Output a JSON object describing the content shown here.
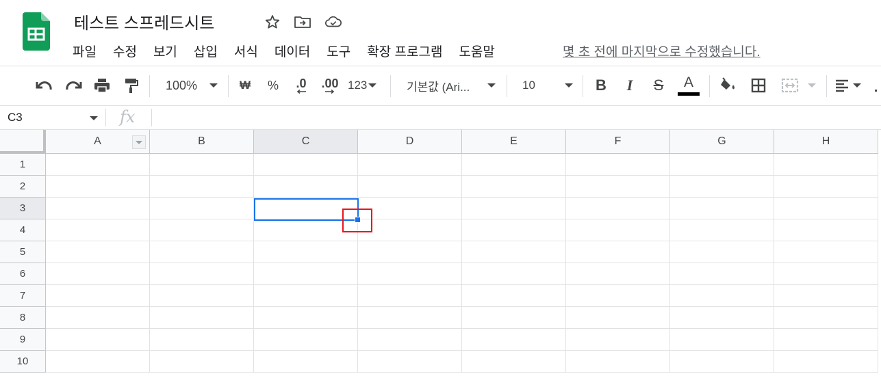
{
  "app": {
    "title": "테스트 스프레드시트",
    "accent": "#1a73e8",
    "brand": "#0f9d58",
    "header_icons": [
      "star-icon",
      "move-to-folder-icon",
      "cloud-saved-icon"
    ]
  },
  "menu": {
    "items": [
      "파일",
      "수정",
      "보기",
      "삽입",
      "서식",
      "데이터",
      "도구",
      "확장 프로그램",
      "도움말"
    ],
    "last_edit": "몇 초 전에 마지막으로 수정했습니다."
  },
  "toolbar": {
    "undo_icon": "undo-icon",
    "redo_icon": "redo-icon",
    "print_icon": "print-icon",
    "paint_format_icon": "paint-format-icon",
    "zoom": "100%",
    "currency": "₩",
    "percent": "%",
    "decrease_decimal": ".0",
    "increase_decimal": ".00",
    "more_formats": "123",
    "font": "기본값 (Ari...",
    "font_size": "10",
    "bold": "B",
    "italic": "I",
    "strikethrough": "S",
    "text_color_letter": "A",
    "text_color": "#000000"
  },
  "formula_bar": {
    "name_box": "C3",
    "fx": "fx",
    "formula": ""
  },
  "sheet": {
    "columns": [
      "A",
      "B",
      "C",
      "D",
      "E",
      "F",
      "G",
      "H"
    ],
    "rows": [
      "1",
      "2",
      "3",
      "4",
      "5",
      "6",
      "7",
      "8",
      "9",
      "10"
    ],
    "selected_cell": "C3",
    "selected_col": "C",
    "selected_row": "3",
    "highlight_color": "#e8161b"
  }
}
